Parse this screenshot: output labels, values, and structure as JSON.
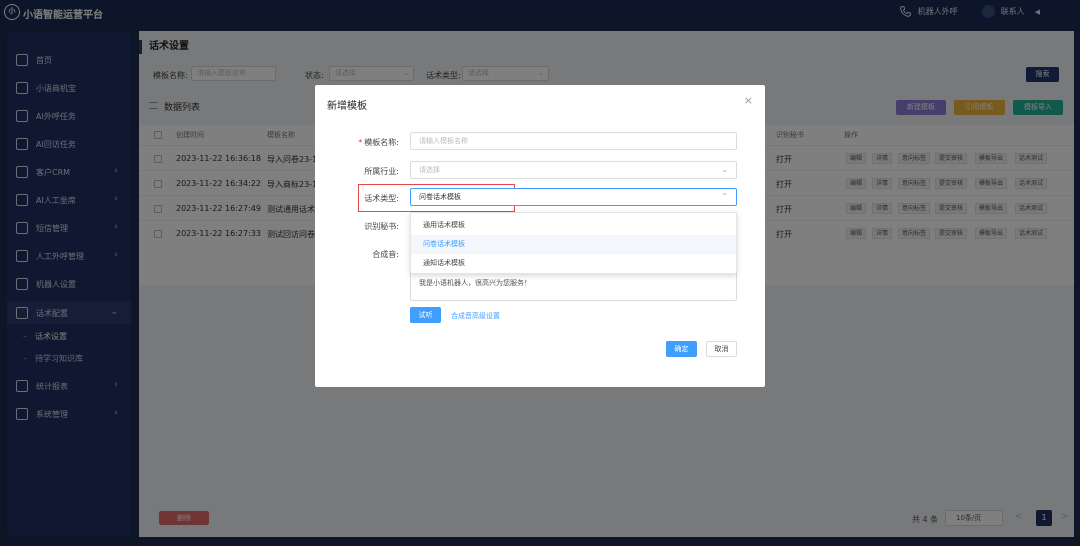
{
  "app": {
    "logo_text": "小",
    "title": "小语智能运营平台"
  },
  "topbar": {
    "outbound_label": "机器人外呼",
    "contact_label": "联系人"
  },
  "sidebar": {
    "items": [
      {
        "label": "首页",
        "icon": "home-icon"
      },
      {
        "label": "小语商机宝",
        "icon": "chart-bars-icon"
      },
      {
        "label": "AI外呼任务",
        "icon": "task-list-icon"
      },
      {
        "label": "AI回访任务",
        "icon": "calendar-icon"
      },
      {
        "label": "客户CRM",
        "icon": "users-icon"
      },
      {
        "label": "AI人工坐席",
        "icon": "agent-icon"
      },
      {
        "label": "短信管理",
        "icon": "message-icon"
      },
      {
        "label": "人工外呼管理",
        "icon": "phone-icon"
      },
      {
        "label": "机器人设置",
        "icon": "robot-icon"
      },
      {
        "label": "话术配置",
        "icon": "script-icon"
      },
      {
        "label": "统计报表",
        "icon": "stats-icon"
      },
      {
        "label": "系统管理",
        "icon": "settings-icon"
      }
    ],
    "sub_items": [
      {
        "label": "话术设置"
      },
      {
        "label": "待学习知识库"
      }
    ]
  },
  "page": {
    "title": "话术设置"
  },
  "filters": {
    "name_label": "模板名称:",
    "name_placeholder": "请输入模板名称",
    "status_label": "状态:",
    "status_placeholder": "请选择",
    "type_label": "话术类型:",
    "type_placeholder": "请选择",
    "search_label": "搜索"
  },
  "list": {
    "title": "数据列表",
    "actions": [
      {
        "label": "新建模板",
        "color": "#8c7fd6"
      },
      {
        "label": "引用模板",
        "color": "#f1b43c"
      },
      {
        "label": "模板导入",
        "color": "#24b39b"
      }
    ],
    "headers": [
      "创建时间",
      "模板名称",
      "识别秘书",
      "操作"
    ],
    "rows": [
      {
        "time": "2023-11-22 16:36:18",
        "name": "导入问卷23-1",
        "secretary": "打开"
      },
      {
        "time": "2023-11-22 16:34:22",
        "name": "导入商标23-1",
        "secretary": "打开"
      },
      {
        "time": "2023-11-22 16:27:49",
        "name": "测试通用话术",
        "secretary": "打开"
      },
      {
        "time": "2023-11-22 16:27:33",
        "name": "测试回访问卷",
        "secretary": "打开"
      }
    ],
    "ops": [
      "编辑",
      "详情",
      "意向标签",
      "提交审核",
      "模板导出",
      "话术测试"
    ]
  },
  "footer": {
    "delete_label": "删除",
    "total": "共 4 条",
    "page_size": "10条/页",
    "prev": "<",
    "current_page": "1",
    "next": ">"
  },
  "modal": {
    "title": "新增模板",
    "close": "×",
    "name_label": "模板名称:",
    "name_placeholder": "请输入模板名称",
    "industry_label": "所属行业:",
    "industry_placeholder": "请选择",
    "type_label": "话术类型:",
    "type_value": "问卷话术模板",
    "secretary_label": "识别秘书:",
    "synth_label": "合成音:",
    "type_options": [
      "通用话术模板",
      "问卷话术模板",
      "通知话术模板"
    ],
    "selected_option": 1,
    "text_value": "我是小语机器人，很高兴为您服务！",
    "try_label": "试听",
    "advanced_label": "合成音高级设置",
    "ok_label": "确定",
    "cancel_label": "取消"
  }
}
